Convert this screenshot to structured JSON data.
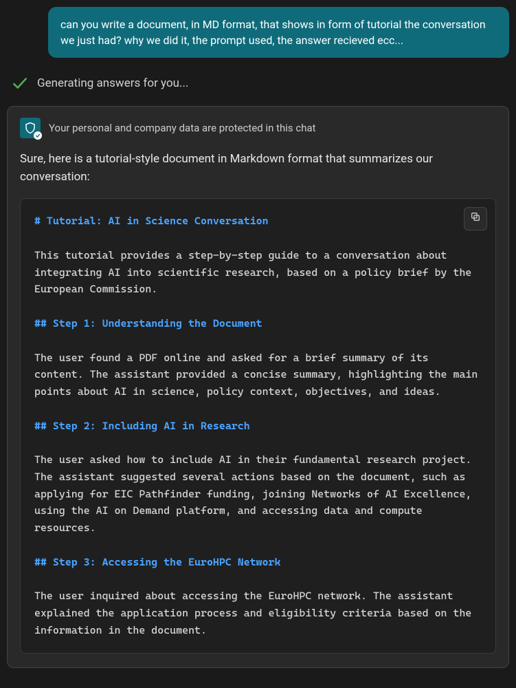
{
  "user_message": "can you write a document, in MD format, that shows in form of tutorial the conversation we just had? why we did it, the prompt used, the answer recieved ecc...",
  "generating_text": "Generating answers for you...",
  "protected_text": "Your personal and company data are protected in this chat",
  "intro_text": "Sure, here is a tutorial-style document in Markdown format that summarizes our conversation:",
  "code": {
    "h1": "# Tutorial: AI in Science Conversation",
    "p1": "This tutorial provides a step-by-step guide to a conversation about integrating AI into scientific research, based on a policy brief by the European Commission.",
    "h2a": "## Step 1: Understanding the Document",
    "p2": "The user found a PDF online and asked for a brief summary of its content. The assistant provided a concise summary, highlighting the main points about AI in science, policy context, objectives, and ideas.",
    "h2b": "## Step 2: Including AI in Research",
    "p3": "The user asked how to include AI in their fundamental research project. The assistant suggested several actions based on the document, such as applying for EIC Pathfinder funding, joining Networks of AI Excellence, using the AI on Demand platform, and accessing data and compute resources.",
    "h2c": "## Step 3: Accessing the EuroHPC Network",
    "p4": "The user inquired about accessing the EuroHPC network. The assistant explained the application process and eligibility criteria based on the information in the document."
  }
}
